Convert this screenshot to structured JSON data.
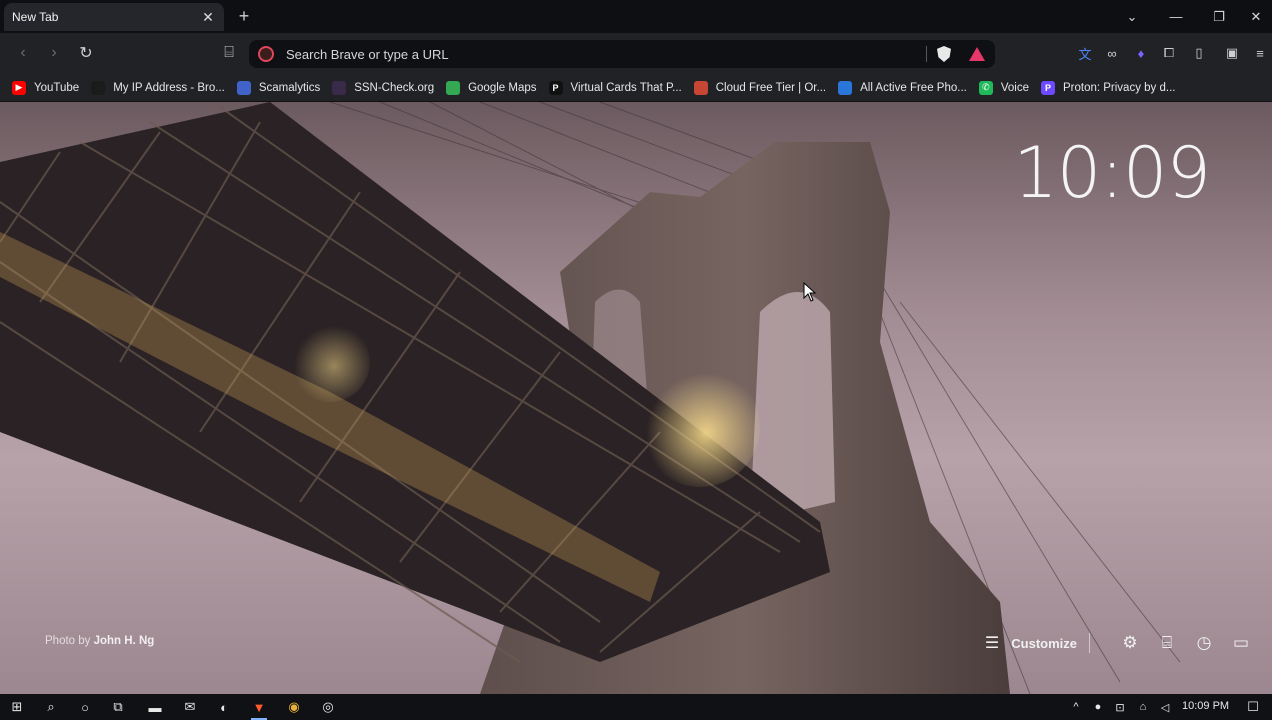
{
  "tab": {
    "title": "New Tab",
    "close_glyph": "✕",
    "new_tab_glyph": "+"
  },
  "window_controls": {
    "tabsearch": "⌄",
    "minimize": "—",
    "restore": "❐",
    "close": "✕"
  },
  "toolbar": {
    "back_glyph": "‹",
    "forward_glyph": "›",
    "reload_glyph": "↻",
    "bookmark_glyph": "⌸",
    "omnibox_placeholder": "Search Brave or type a URL",
    "extensions": [
      "translate-icon",
      "glasses-icon",
      "flame-icon",
      "puzzle-icon",
      "sidebar-icon",
      "wallet-icon",
      "menu-icon"
    ]
  },
  "bookmarks": [
    {
      "label": "YouTube",
      "icon": "youtube-icon",
      "color": "#ff0000",
      "glyph": "▶"
    },
    {
      "label": "My IP Address - Bro...",
      "icon": "mask-icon",
      "color": "#1b1b1b",
      "glyph": ""
    },
    {
      "label": "Scamalytics",
      "icon": "shield-icon",
      "color": "#3f63c8",
      "glyph": ""
    },
    {
      "label": "SSN-Check.org",
      "icon": "ssn-icon",
      "color": "#3a2a4a",
      "glyph": ""
    },
    {
      "label": "Google Maps",
      "icon": "map-pin-icon",
      "color": "#34a853",
      "glyph": ""
    },
    {
      "label": "Virtual Cards That P...",
      "icon": "p-icon",
      "color": "#111111",
      "glyph": "P"
    },
    {
      "label": "Cloud Free Tier | Or...",
      "icon": "oracle-icon",
      "color": "#c74634",
      "glyph": ""
    },
    {
      "label": "All Active Free Pho...",
      "icon": "phone-site-icon",
      "color": "#2b77d9",
      "glyph": ""
    },
    {
      "label": "Voice",
      "icon": "phone-icon",
      "color": "#20b95a",
      "glyph": "✆"
    },
    {
      "label": "Proton: Privacy by d...",
      "icon": "proton-icon",
      "color": "#6d4aff",
      "glyph": "P"
    }
  ],
  "ntp": {
    "clock": "10:09",
    "credit_prefix": "Photo by",
    "credit_name": "John H. Ng",
    "customize_label": "Customize",
    "customize_glyph": "☰",
    "tools": [
      {
        "name": "settings-icon",
        "glyph": "⚙"
      },
      {
        "name": "bookmarks-icon",
        "glyph": "⌸"
      },
      {
        "name": "history-icon",
        "glyph": "◷"
      },
      {
        "name": "video-call-icon",
        "glyph": "▭"
      }
    ]
  },
  "taskbar": {
    "time": "10:09 PM",
    "items": [
      {
        "name": "start-icon",
        "glyph": "⊞"
      },
      {
        "name": "search-icon",
        "glyph": "⌕"
      },
      {
        "name": "cortana-icon",
        "glyph": "○"
      },
      {
        "name": "task-view-icon",
        "glyph": "⧉"
      },
      {
        "name": "file-explorer-icon",
        "glyph": "▬"
      },
      {
        "name": "mail-icon",
        "glyph": "✉"
      },
      {
        "name": "edge-icon",
        "glyph": "◐"
      },
      {
        "name": "brave-icon",
        "glyph": "▼"
      },
      {
        "name": "chrome-icon",
        "glyph": "◉"
      },
      {
        "name": "app-icon",
        "glyph": "◎"
      }
    ],
    "tray": [
      {
        "name": "tray-chevron-icon",
        "glyph": "^"
      },
      {
        "name": "microphone-icon",
        "glyph": "●"
      },
      {
        "name": "network-share-icon",
        "glyph": "⊡"
      },
      {
        "name": "network-icon",
        "glyph": "⌂"
      },
      {
        "name": "volume-icon",
        "glyph": "◁"
      }
    ],
    "notification_glyph": "☐"
  }
}
